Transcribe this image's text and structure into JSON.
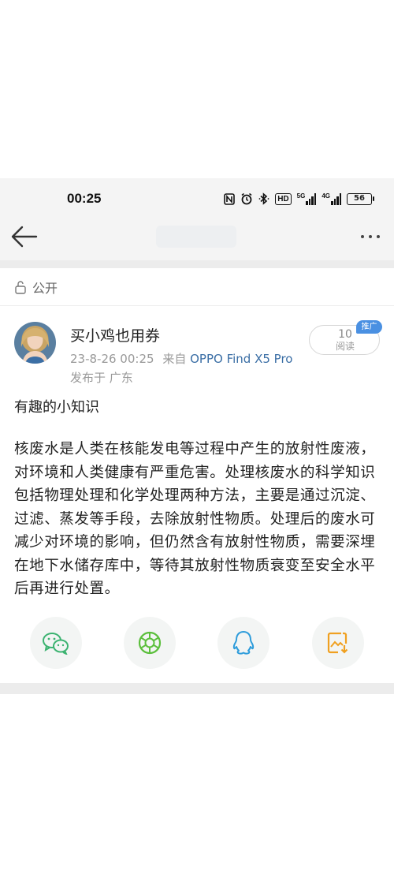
{
  "status_bar": {
    "time": "00:25",
    "network_5g": "5G",
    "network_4g": "4G",
    "hd_label": "HD",
    "battery": "56"
  },
  "nav": {
    "back_icon": "back-arrow-icon",
    "more_icon": "more-dots-icon"
  },
  "visibility": {
    "icon": "lock-open-icon",
    "label": "公开"
  },
  "post": {
    "author": "买小鸡也用券",
    "date": "23-8-26 00:25",
    "from_label": "来自",
    "device": "OPPO Find X5 Pro",
    "location": "发布于 广东",
    "read_count": "10",
    "read_label": "阅读",
    "promo_tag": "推广",
    "title": "有趣的小知识",
    "body": "核废水是人类在核能发电等过程中产生的放射性废液，对环境和人类健康有严重危害。处理核废水的科学知识包括物理处理和化学处理两种方法，主要是通过沉淀、过滤、蒸发等手段，去除放射性物质。处理后的废水可减少对环境的影响，但仍然含有放射性物质，需要深埋在地下水储存库中，等待其放射性物质衰变至安全水平后再进行处置。"
  },
  "share": [
    {
      "icon": "wechat-icon",
      "color": "#3cb371"
    },
    {
      "icon": "moments-icon",
      "color": "#5bbf3c"
    },
    {
      "icon": "qq-icon",
      "color": "#2d9cdb"
    },
    {
      "icon": "save-image-icon",
      "color": "#f0a020"
    }
  ],
  "colors": {
    "accent": "#3a6ea5",
    "promo": "#4a90e2"
  }
}
